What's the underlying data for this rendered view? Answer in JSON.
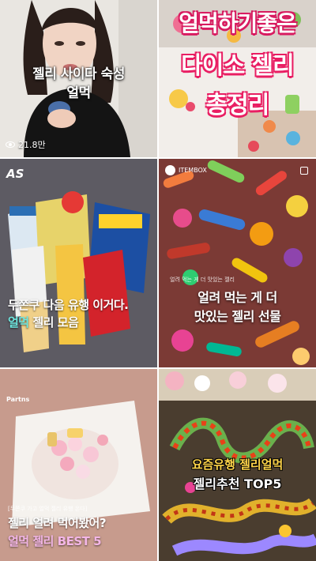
{
  "videos": [
    {
      "caption_line1": "젤리 사이다 숙성",
      "caption_line2": "얼먹",
      "views": "21.8만"
    },
    {
      "title_line1": "얼먹하기좋은",
      "title_line2": "다이소 젤리",
      "title_line3": "총정리"
    },
    {
      "logo": "AS",
      "caption_line1": "두쫀쿠 다음 유행 이거다.",
      "caption_line2_highlight": "얼먹",
      "caption_line2_rest": " 젤리 모음"
    },
    {
      "badge": "ITEMBOX",
      "small_text": "얼려 먹는 게 더 맛있는 젤리",
      "caption_line1": "얼려 먹는 게 더",
      "caption_line2": "맛있는 젤리 선물"
    },
    {
      "logo": "Partns",
      "small_text": "[두쫀쿠 가고 얼먹 젤리 유행 온다]",
      "caption_line1": "젤리 얼려 먹어봤어?",
      "caption_line2": "얼먹 젤리 BEST 5"
    },
    {
      "caption_line1": "요즘유행 젤리얼먹",
      "caption_line2": "젤리추천 TOP5"
    }
  ],
  "colors": {
    "teal": "#6ee7e0",
    "pink_title": "#e91e63",
    "yellow": "#ffd54a",
    "pink_caption": "#f3b6e6"
  }
}
